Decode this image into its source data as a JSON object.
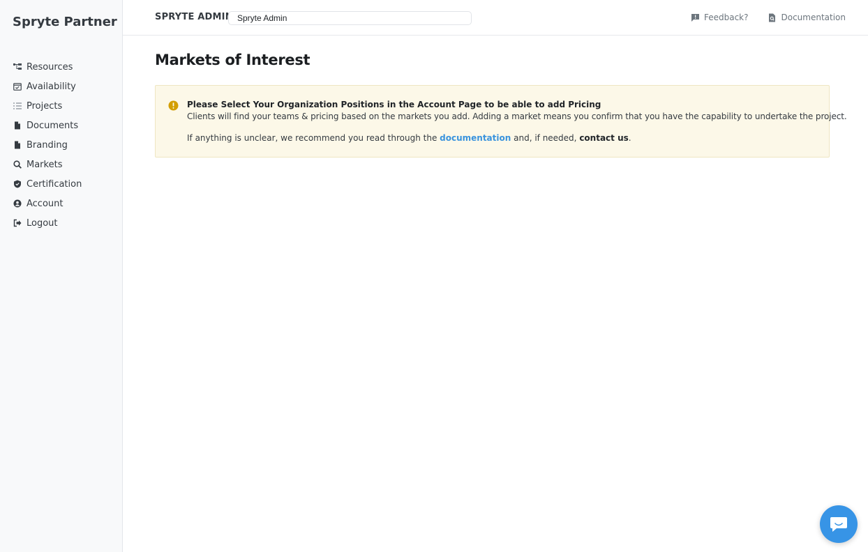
{
  "brand": "Spryte Partner",
  "sidebar": {
    "items": [
      {
        "label": "Resources",
        "icon": "sitemap-icon"
      },
      {
        "label": "Availability",
        "icon": "calendar-check-icon"
      },
      {
        "label": "Projects",
        "icon": "list-icon"
      },
      {
        "label": "Documents",
        "icon": "file-icon"
      },
      {
        "label": "Branding",
        "icon": "file-icon"
      },
      {
        "label": "Markets",
        "icon": "search-icon"
      },
      {
        "label": "Certification",
        "icon": "shield-icon"
      },
      {
        "label": "Account",
        "icon": "user-circle-icon"
      },
      {
        "label": "Logout",
        "icon": "sign-out-icon"
      }
    ]
  },
  "topbar": {
    "org_label": "SPRYTE ADMIN",
    "org_select_value": "Spryte Admin",
    "feedback_label": "Feedback?",
    "documentation_label": "Documentation"
  },
  "main": {
    "title": "Markets of Interest",
    "alert": {
      "title": "Please Select Your Organization Positions in the Account Page to be able to add Pricing",
      "body": "Clients will find your teams & pricing based on the markets you add. Adding a market means you confirm that you have the capability to undertake the project.",
      "line2_prefix": "If anything is unclear, we recommend you read through the ",
      "line2_link": "documentation",
      "line2_middle": " and, if needed, ",
      "line2_contact": "contact us",
      "line2_suffix": "."
    }
  },
  "colors": {
    "accent": "#3794e6",
    "link": "#3a93dd",
    "alert_bg": "#fcf8e8",
    "warning_icon": "#d39e00"
  }
}
